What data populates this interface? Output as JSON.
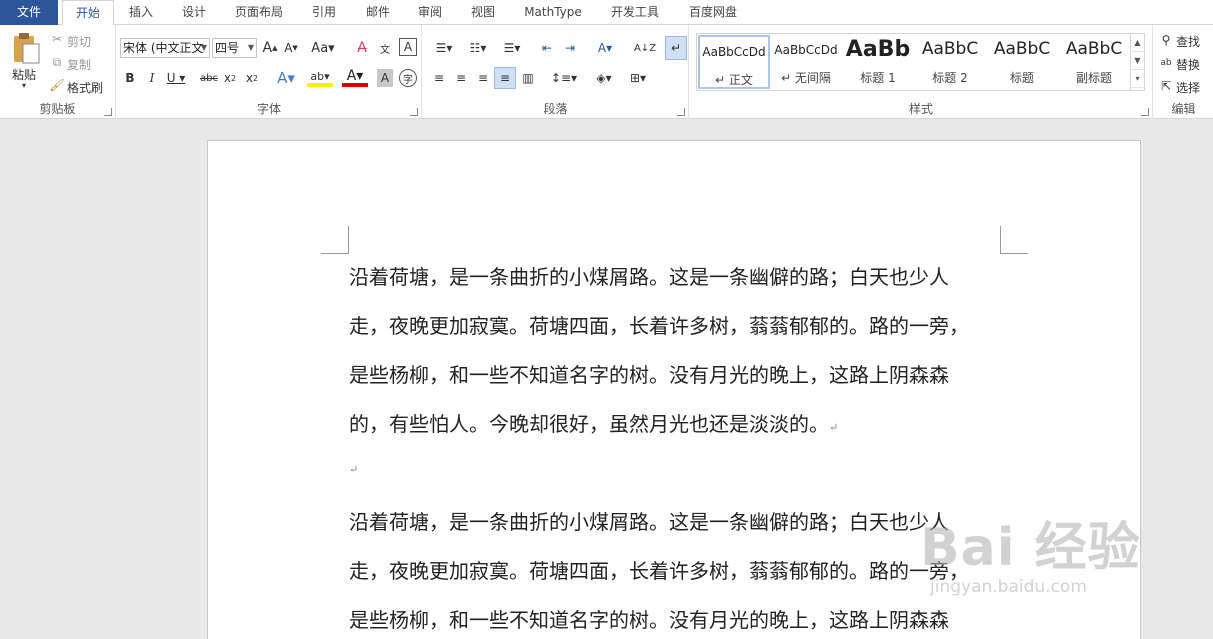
{
  "tabs": [
    "文件",
    "开始",
    "插入",
    "设计",
    "页面布局",
    "引用",
    "邮件",
    "审阅",
    "视图",
    "MathType",
    "开发工具",
    "百度网盘"
  ],
  "clipboard": {
    "paste": "粘贴",
    "cut": "剪切",
    "copy": "复制",
    "format_painter": "格式刷",
    "label": "剪贴板"
  },
  "font": {
    "name": "宋体 (中文正文",
    "size": "四号",
    "label": "字体"
  },
  "paragraph": {
    "label": "段落"
  },
  "styles": {
    "label": "样式",
    "items": [
      {
        "preview": "AaBbCcDd",
        "name": "↵ 正文"
      },
      {
        "preview": "AaBbCcDd",
        "name": "↵ 无间隔"
      },
      {
        "preview": "AaBb",
        "name": "标题 1"
      },
      {
        "preview": "AaBbC",
        "name": "标题 2"
      },
      {
        "preview": "AaBbC",
        "name": "标题"
      },
      {
        "preview": "AaBbC",
        "name": "副标题"
      }
    ]
  },
  "editing": {
    "find": "查找",
    "replace": "替换",
    "select": "选择",
    "label": "编辑"
  },
  "document": {
    "para1": [
      "沿着荷塘，是一条曲折的小煤屑路。这是一条幽僻的路；白天也少人",
      "走，夜晚更加寂寞。荷塘四面，长着许多树，蓊蓊郁郁的。路的一旁，",
      "是些杨柳，和一些不知道名字的树。没有月光的晚上，这路上阴森森",
      "的，有些怕人。今晚却很好，虽然月光也还是淡淡的。"
    ],
    "para2": [
      "沿着荷塘，是一条曲折的小煤屑路。这是一条幽僻的路；白天也少人",
      "走，夜晚更加寂寞。荷塘四面，长着许多树，蓊蓊郁郁的。路的一旁，",
      "是些杨柳，和一些不知道名字的树。没有月光的晚上，这路上阴森森"
    ],
    "return_mark": "↵"
  },
  "watermark": {
    "logo": "Bai 经验",
    "url": "jingyan.baidu.com"
  }
}
